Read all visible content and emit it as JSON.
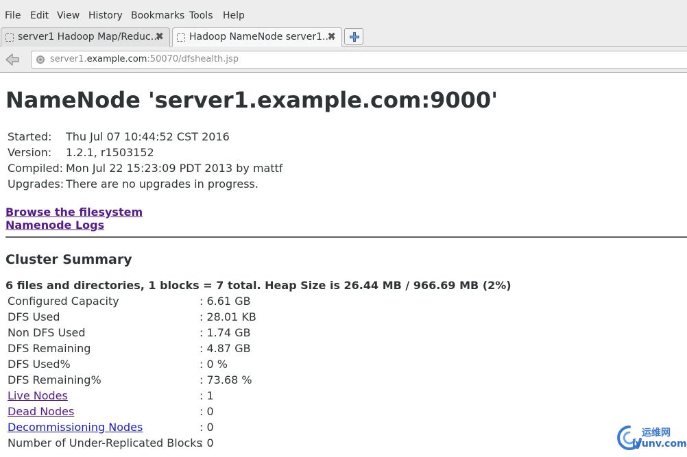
{
  "menubar": {
    "items": [
      "File",
      "Edit",
      "View",
      "History",
      "Bookmarks",
      "Tools",
      "Help"
    ]
  },
  "tabs": [
    {
      "title": "server1 Hadoop Map/Reduc…",
      "close": "✖",
      "active": false
    },
    {
      "title": "Hadoop NameNode server1.…",
      "close": "✖",
      "active": true
    }
  ],
  "newtab": {
    "icon": "plus-icon"
  },
  "navbar": {
    "url_prefix": "server1.",
    "url_host": "example.com",
    "url_suffix": ":50070/dfshealth.jsp"
  },
  "page": {
    "title": "NameNode 'server1.example.com:9000'",
    "info": [
      {
        "key": "Started:",
        "value": "Thu Jul 07 10:44:52 CST 2016"
      },
      {
        "key": "Version:",
        "value": "1.2.1, r1503152"
      },
      {
        "key": "Compiled:",
        "value": "Mon Jul 22 15:23:09 PDT 2013 by mattf"
      },
      {
        "key": "Upgrades:",
        "value": "There are no upgrades in progress."
      }
    ],
    "links": {
      "browse": "Browse the filesystem",
      "logs": "Namenode Logs"
    },
    "cluster_title": "Cluster Summary",
    "summary_line": "6 files and directories, 1 blocks = 7 total. Heap Size is 26.44 MB / 966.69 MB (2%)",
    "cluster": [
      {
        "key": "Configured Capacity",
        "value": ": 6.61 GB"
      },
      {
        "key": "DFS Used",
        "value": ": 28.01 KB"
      },
      {
        "key": "Non DFS Used",
        "value": ": 1.74 GB"
      },
      {
        "key": "DFS Remaining",
        "value": ": 4.87 GB"
      },
      {
        "key": "DFS Used%",
        "value": ": 0 %"
      },
      {
        "key": "DFS Remaining%",
        "value": ": 73.68 %"
      },
      {
        "key": "Live Nodes",
        "value": ": 1"
      },
      {
        "key": "Dead Nodes",
        "value": ": 0"
      },
      {
        "key": "Decommissioning Nodes",
        "value": ": 0"
      },
      {
        "key": "Number of Under-Replicated Blocks",
        "value": ": 0"
      }
    ]
  },
  "watermark": {
    "cn": "运维网",
    "en": "iyunv.com"
  },
  "colors": {
    "visited_link": "#551a8b",
    "link": "#1a1ac8",
    "text": "#2e3436"
  }
}
